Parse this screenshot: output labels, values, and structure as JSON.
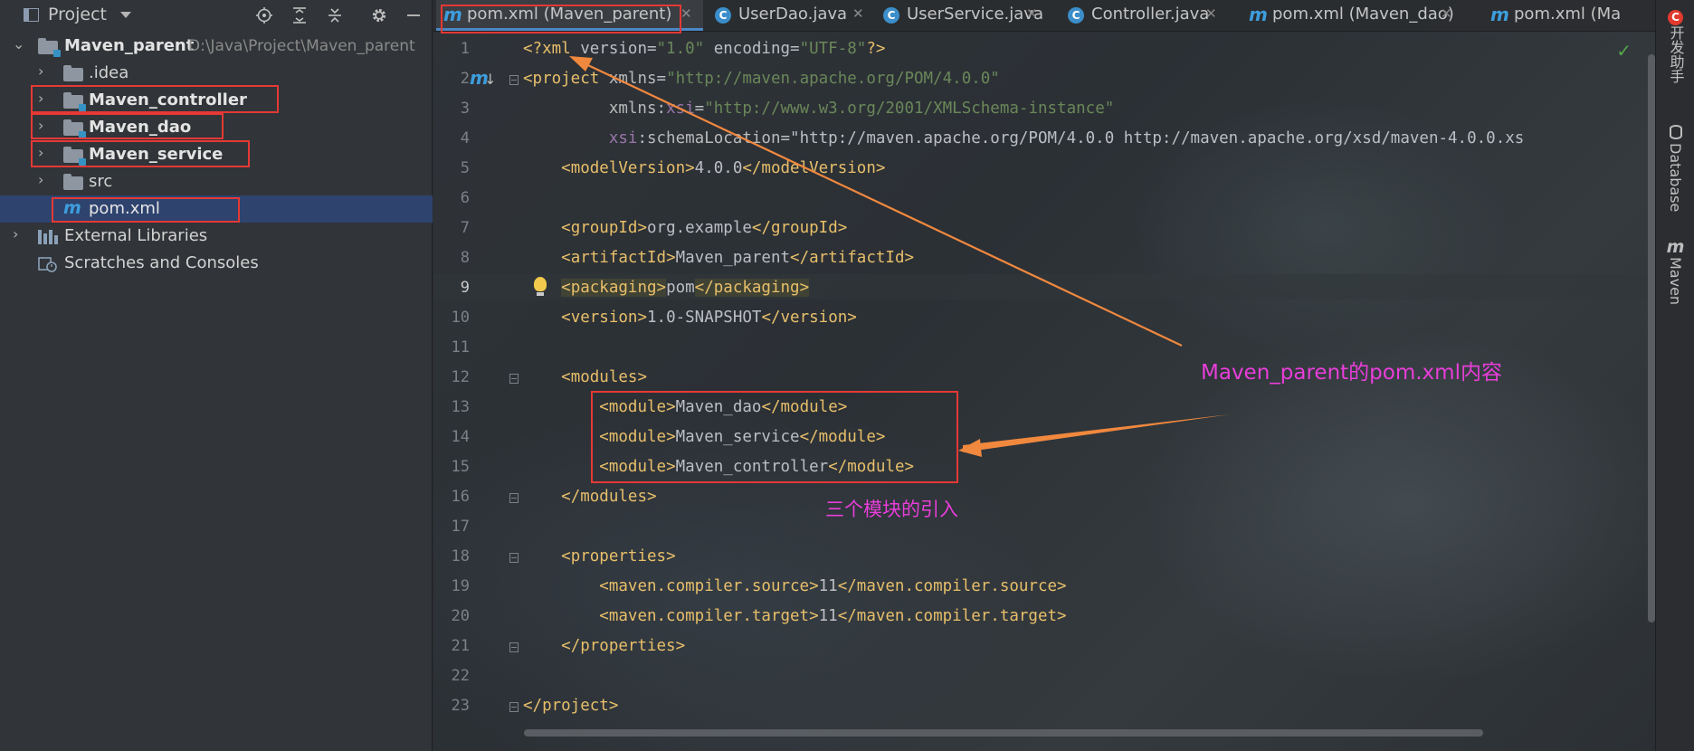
{
  "project_panel": {
    "title": "Project",
    "tree": [
      {
        "label": "Maven_parent",
        "path": "D:\\Java\\Project\\Maven_parent"
      },
      {
        "label": ".idea"
      },
      {
        "label": "Maven_controller"
      },
      {
        "label": "Maven_dao"
      },
      {
        "label": "Maven_service"
      },
      {
        "label": "src"
      },
      {
        "label": "pom.xml"
      },
      {
        "label": "External Libraries"
      },
      {
        "label": "Scratches and Consoles"
      }
    ]
  },
  "tabs": [
    {
      "label": "pom.xml (Maven_parent)",
      "icon": "maven-icon"
    },
    {
      "label": "UserDao.java",
      "icon": "class-icon"
    },
    {
      "label": "UserService.java",
      "icon": "class-icon"
    },
    {
      "label": "Controller.java",
      "icon": "class-icon"
    },
    {
      "label": "pom.xml (Maven_dao)",
      "icon": "maven-icon"
    },
    {
      "label": "pom.xml (Ma",
      "icon": "maven-icon"
    }
  ],
  "editor": {
    "line_numbers": [
      "1",
      "2",
      "3",
      "4",
      "5",
      "6",
      "7",
      "8",
      "9",
      "10",
      "11",
      "12",
      "13",
      "14",
      "15",
      "16",
      "17",
      "18",
      "19",
      "20",
      "21",
      "22",
      "23"
    ],
    "current_line": "9",
    "code_lines": [
      "<?xml version=\"1.0\" encoding=\"UTF-8\"?>",
      "<project xmlns=\"http://maven.apache.org/POM/4.0.0\"",
      "         xmlns:xsi=\"http://www.w3.org/2001/XMLSchema-instance\"",
      "         xsi:schemaLocation=\"http://maven.apache.org/POM/4.0.0 http://maven.apache.org/xsd/maven-4.0.0.xs",
      "    <modelVersion>4.0.0</modelVersion>",
      "",
      "    <groupId>org.example</groupId>",
      "    <artifactId>Maven_parent</artifactId>",
      "    <packaging>pom</packaging>",
      "    <version>1.0-SNAPSHOT</version>",
      "",
      "    <modules>",
      "        <module>Maven_dao</module>",
      "        <module>Maven_service</module>",
      "        <module>Maven_controller</module>",
      "    </modules>",
      "",
      "    <properties>",
      "        <maven.compiler.source>11</maven.compiler.source>",
      "        <maven.compiler.target>11</maven.compiler.target>",
      "    </properties>",
      "",
      "</project>"
    ]
  },
  "annotations": {
    "pom_content": "Maven_parent的pom.xml内容",
    "modules_intro": "三个模块的引入"
  },
  "right_strip": {
    "dev_helper": "开发助手",
    "dev_helper_badge": "C",
    "database": "Database",
    "maven": "Maven",
    "maven_glyph": "m"
  },
  "colors": {
    "annotation_text": "#e83ed9",
    "annotation_arrow": "#f0883e",
    "highlight_box": "#e53935",
    "selected_row": "#2e436e",
    "xml_tag": "#e8bf6a",
    "xml_string": "#6a8759"
  }
}
